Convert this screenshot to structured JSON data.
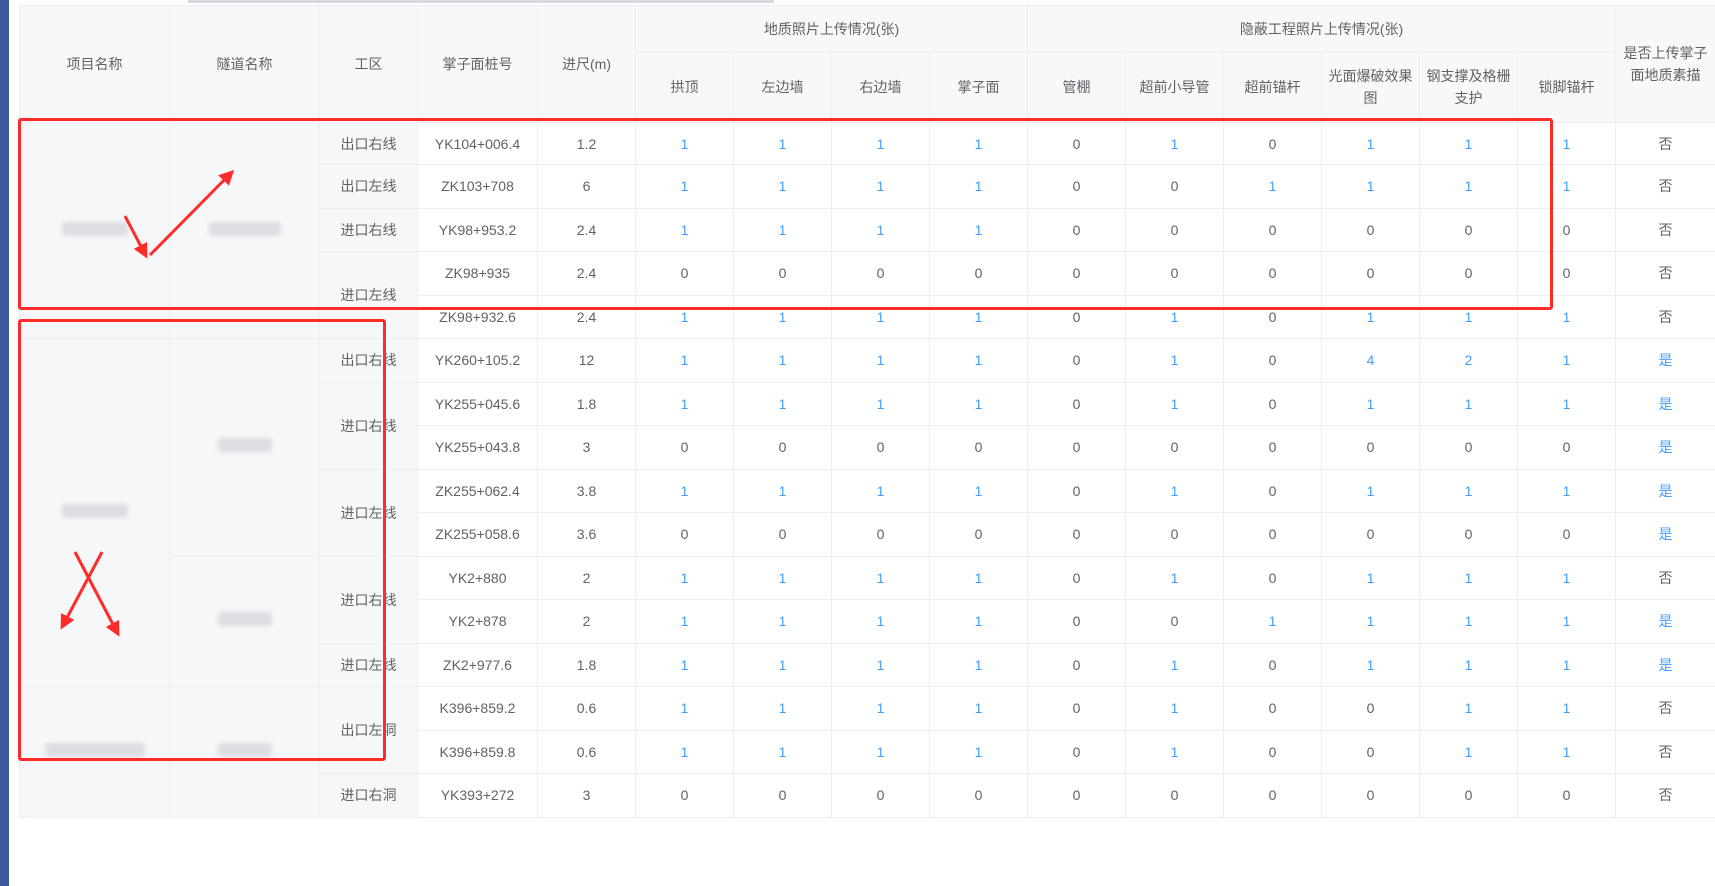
{
  "headers": {
    "project": "项目名称",
    "tunnel": "隧道名称",
    "work_area": "工区",
    "face_station": "掌子面桩号",
    "advance": "进尺(m)",
    "geo_group": "地质照片上传情况(张)",
    "hidden_group": "隐蔽工程照片上传情况(张)",
    "sketch": "是否上传掌子面地质素描",
    "geo_cols": [
      "拱顶",
      "左边墙",
      "右边墙",
      "掌子面"
    ],
    "hidden_cols": [
      "管棚",
      "超前小导管",
      "超前锚杆",
      "光面爆破效果图",
      "钢支撑及格栅支护",
      "锁脚锚杆"
    ]
  },
  "rows": [
    {
      "area": "出口右线",
      "station": "YK104+006.4",
      "advance": "1.2",
      "vals": [
        "1",
        "1",
        "1",
        "1",
        "0",
        "1",
        "0",
        "1",
        "1",
        "1"
      ],
      "sketch": "否"
    },
    {
      "area": "出口左线",
      "station": "ZK103+708",
      "advance": "6",
      "vals": [
        "1",
        "1",
        "1",
        "1",
        "0",
        "0",
        "1",
        "1",
        "1",
        "1"
      ],
      "sketch": "否"
    },
    {
      "area": "进口右线",
      "station": "YK98+953.2",
      "advance": "2.4",
      "vals": [
        "1",
        "1",
        "1",
        "1",
        "0",
        "0",
        "0",
        "0",
        "0",
        "0"
      ],
      "sketch": "否"
    },
    {
      "area": "进口左线",
      "station": "ZK98+935",
      "advance": "2.4",
      "vals": [
        "0",
        "0",
        "0",
        "0",
        "0",
        "0",
        "0",
        "0",
        "0",
        "0"
      ],
      "sketch": "否"
    },
    {
      "area": "",
      "station": "ZK98+932.6",
      "advance": "2.4",
      "vals": [
        "1",
        "1",
        "1",
        "1",
        "0",
        "1",
        "0",
        "1",
        "1",
        "1"
      ],
      "sketch": "否"
    },
    {
      "area": "出口右线",
      "station": "YK260+105.2",
      "advance": "12",
      "vals": [
        "1",
        "1",
        "1",
        "1",
        "0",
        "1",
        "0",
        "4",
        "2",
        "1"
      ],
      "sketch": "是"
    },
    {
      "area": "进口右线",
      "station": "YK255+045.6",
      "advance": "1.8",
      "vals": [
        "1",
        "1",
        "1",
        "1",
        "0",
        "1",
        "0",
        "1",
        "1",
        "1"
      ],
      "sketch": "是"
    },
    {
      "area": "",
      "station": "YK255+043.8",
      "advance": "3",
      "vals": [
        "0",
        "0",
        "0",
        "0",
        "0",
        "0",
        "0",
        "0",
        "0",
        "0"
      ],
      "sketch": "是"
    },
    {
      "area": "进口左线",
      "station": "ZK255+062.4",
      "advance": "3.8",
      "vals": [
        "1",
        "1",
        "1",
        "1",
        "0",
        "1",
        "0",
        "1",
        "1",
        "1"
      ],
      "sketch": "是"
    },
    {
      "area": "",
      "station": "ZK255+058.6",
      "advance": "3.6",
      "vals": [
        "0",
        "0",
        "0",
        "0",
        "0",
        "0",
        "0",
        "0",
        "0",
        "0"
      ],
      "sketch": "是"
    },
    {
      "area": "进口右线",
      "station": "YK2+880",
      "advance": "2",
      "vals": [
        "1",
        "1",
        "1",
        "1",
        "0",
        "1",
        "0",
        "1",
        "1",
        "1"
      ],
      "sketch": "否"
    },
    {
      "area": "",
      "station": "YK2+878",
      "advance": "2",
      "vals": [
        "1",
        "1",
        "1",
        "1",
        "0",
        "0",
        "1",
        "1",
        "1",
        "1"
      ],
      "sketch": "是"
    },
    {
      "area": "进口左线",
      "station": "ZK2+977.6",
      "advance": "1.8",
      "vals": [
        "1",
        "1",
        "1",
        "1",
        "0",
        "1",
        "0",
        "1",
        "1",
        "1"
      ],
      "sketch": "是"
    },
    {
      "area": "出口左洞",
      "station": "K396+859.2",
      "advance": "0.6",
      "vals": [
        "1",
        "1",
        "1",
        "1",
        "0",
        "1",
        "0",
        "0",
        "1",
        "1"
      ],
      "sketch": "否"
    },
    {
      "area": "",
      "station": "K396+859.8",
      "advance": "0.6",
      "vals": [
        "1",
        "1",
        "1",
        "1",
        "0",
        "1",
        "0",
        "0",
        "1",
        "1"
      ],
      "sketch": "否"
    },
    {
      "area": "进口右洞",
      "station": "YK393+272",
      "advance": "3",
      "vals": [
        "0",
        "0",
        "0",
        "0",
        "0",
        "0",
        "0",
        "0",
        "0",
        "0"
      ],
      "sketch": "否"
    }
  ],
  "colors": {
    "accent_blue": "#409eff",
    "annotation_red": "#ff2b2b",
    "border": "#ebeef5",
    "header_bg": "#f8f8fa"
  }
}
